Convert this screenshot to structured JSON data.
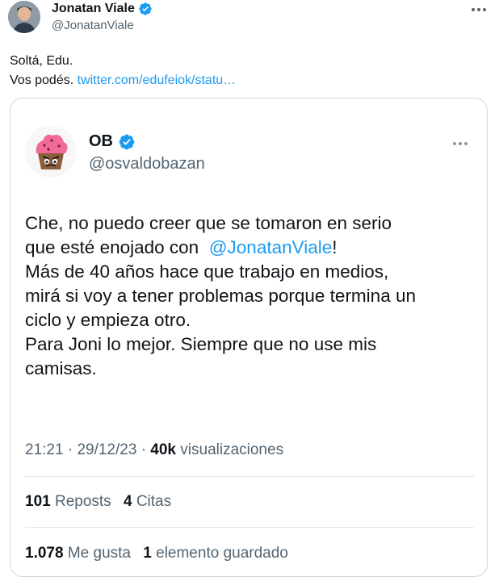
{
  "outer_tweet": {
    "author_name": "Jonatan Viale",
    "author_handle": "@JonatanViale",
    "text_line1": "Soltá, Edu.",
    "text_line2_prefix": "Vos podés.",
    "link_text": "twitter.com/edufeiok/statu…"
  },
  "quoted_tweet": {
    "author_name": "OB",
    "author_handle": "@osvaldobazan",
    "text": {
      "line1": "Che, no puedo creer que se tomaron en serio",
      "line2_prefix": "que esté enojado con",
      "mention": "@JonatanViale",
      "line2_suffix": "!",
      "line3": "Más de 40 años hace que trabajo en medios,",
      "line4": "mirá si voy a tener problemas porque termina un",
      "line5": "ciclo y empieza otro.",
      "line6": "Para Joni lo mejor. Siempre que no use mis",
      "line7": "camisas."
    },
    "meta": {
      "time": "21:21",
      "separator": "·",
      "date": "29/12/23",
      "views_count": "40k",
      "views_label": "visualizaciones"
    },
    "stats": {
      "reposts_count": "101",
      "reposts_label": "Reposts",
      "quotes_count": "4",
      "quotes_label": "Citas",
      "likes_count": "1.078",
      "likes_label": "Me gusta",
      "bookmarks_count": "1",
      "bookmarks_label": "elemento guardado"
    }
  },
  "icons": {
    "verified": "verified-badge-icon",
    "more": "more-options-icon"
  },
  "colors": {
    "link": "#1d9bf0",
    "verified": "#1d9bf0",
    "text_primary": "#0f1419",
    "text_secondary": "#536471",
    "border": "#cfd9de"
  }
}
